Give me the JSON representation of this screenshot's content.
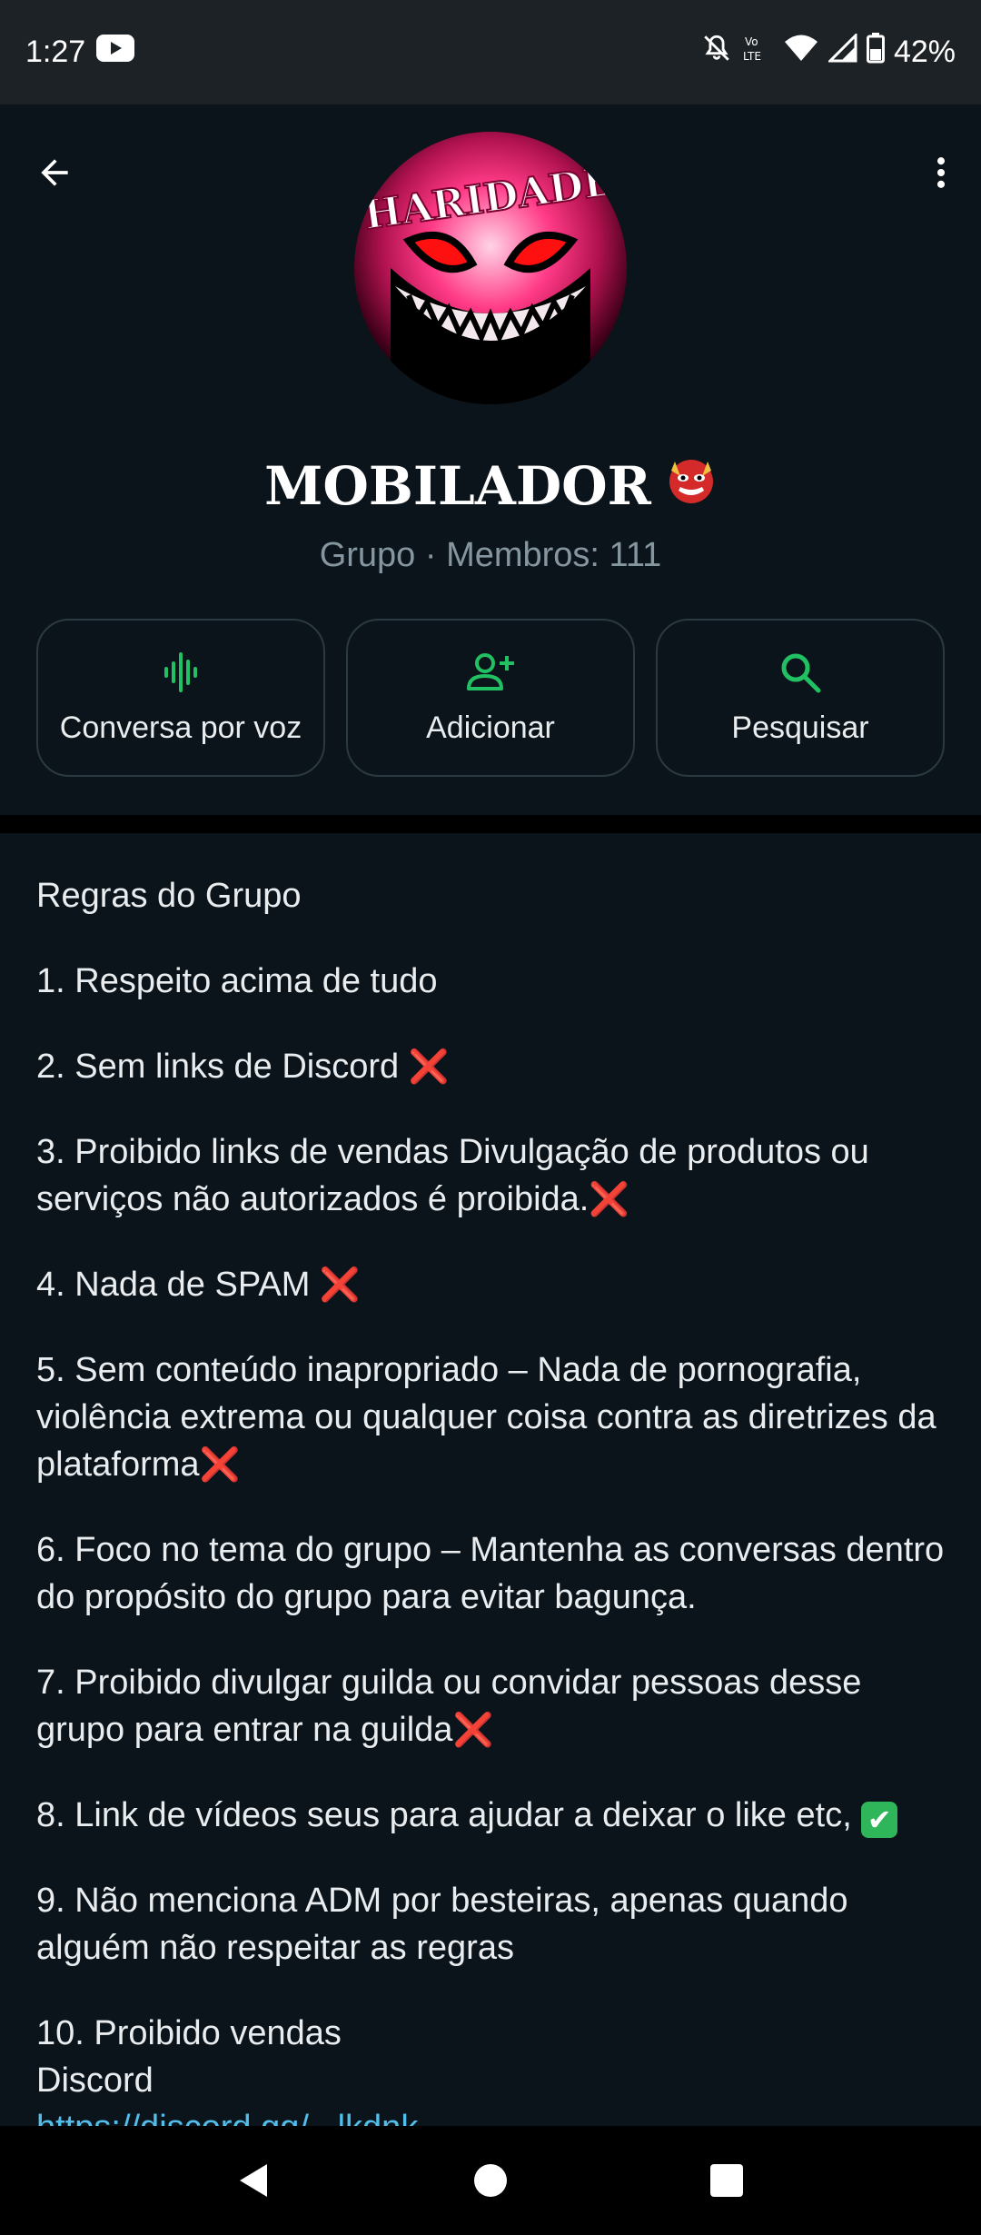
{
  "status_bar": {
    "time": "1:27",
    "battery": "42%",
    "icons": [
      "youtube-icon",
      "mute-icon",
      "volte-icon",
      "wifi-icon",
      "signal-icon",
      "battery-icon"
    ]
  },
  "header": {
    "back_icon": "arrow-left-icon",
    "menu_icon": "more-vert-icon",
    "avatar_text": "HARIDADE",
    "group_name": "MOBILADOR",
    "group_emoji": "goblin-mask-emoji",
    "subtitle": "Grupo · Membros: 111"
  },
  "actions": [
    {
      "label": "Conversa por voz",
      "icon": "voice-wave-icon"
    },
    {
      "label": "Adicionar",
      "icon": "add-person-icon"
    },
    {
      "label": "Pesquisar",
      "icon": "search-icon"
    }
  ],
  "description": {
    "title": "Regras do Grupo",
    "rules": [
      {
        "text": "1. Respeito acima de tudo",
        "mark": ""
      },
      {
        "text": "2. Sem links de Discord ",
        "mark": "❌"
      },
      {
        "text": "3. Proibido links de vendas  Divulgação de produtos ou serviços não autorizados é proibida.",
        "mark": "❌"
      },
      {
        "text": "4. Nada de SPAM ",
        "mark": "❌"
      },
      {
        "text": "5. Sem conteúdo inapropriado – Nada de pornografia, violência extrema ou qualquer coisa contra as diretrizes da plataforma",
        "mark": "❌"
      },
      {
        "text": "6. Foco no tema do grupo – Mantenha as conversas dentro do propósito do grupo para evitar bagunça.",
        "mark": ""
      },
      {
        "text": "7. Proibido divulgar guilda ou convidar pessoas desse grupo para entrar na guilda",
        "mark": "❌"
      },
      {
        "text": "8. Link de vídeos seus para ajudar a deixar o like etc, ",
        "mark": "✔"
      },
      {
        "text": "9. Não menciona ADM por besteiras, apenas quando alguém  não respeitar as regras",
        "mark": ""
      }
    ],
    "rule10_line1": "10. Proibido vendas",
    "rule10_line2": "Discord",
    "link_partial": "https://discord.gg/...lkdnk..."
  },
  "nav_bar": {
    "back": "nav-back-icon",
    "home": "nav-home-icon",
    "recents": "nav-recents-icon"
  },
  "colors": {
    "background": "#0b141a",
    "accent_green": "#21c063",
    "link": "#53bdeb",
    "red_x": "#e0342f"
  }
}
